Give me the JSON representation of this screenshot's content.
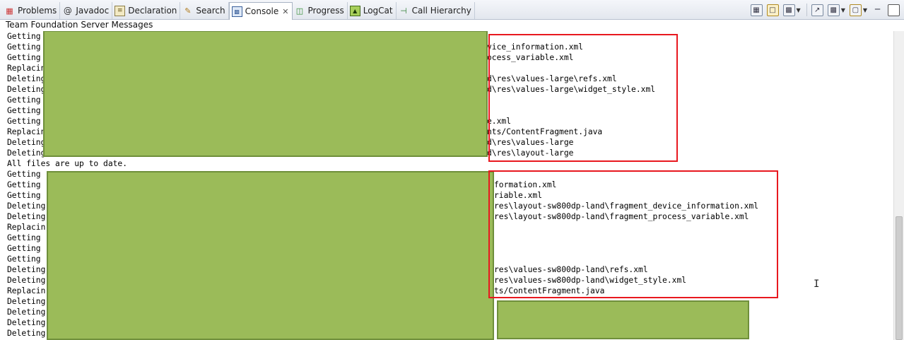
{
  "tabs": [
    {
      "label": "Problems",
      "icon": "problems-icon"
    },
    {
      "label": "Javadoc",
      "icon": "at-sign-icon"
    },
    {
      "label": "Declaration",
      "icon": "declaration-icon"
    },
    {
      "label": "Search",
      "icon": "search-icon"
    },
    {
      "label": "Console",
      "icon": "console-icon",
      "active": true
    },
    {
      "label": "Progress",
      "icon": "progress-icon"
    },
    {
      "label": "LogCat",
      "icon": "logcat-icon"
    },
    {
      "label": "Call Hierarchy",
      "icon": "call-hierarchy-icon"
    }
  ],
  "toolbar_icons": [
    "clear-console-icon",
    "scroll-lock-icon",
    "display-selected-console-icon",
    "pin-console-icon",
    "open-console-icon",
    "new-console-icon",
    "minimize-icon",
    "maximize-icon"
  ],
  "console": {
    "title": "Team Foundation Server Messages",
    "prefixes": [
      "Getting",
      "Getting",
      "Getting",
      "Replacin",
      "Deleting",
      "Deleting",
      "Getting",
      "Getting",
      "Getting",
      "Replacin",
      "Deleting",
      "Deleting",
      "All files are up to date.",
      "Getting",
      "Getting",
      "Getting",
      "Deleting",
      "Deleting",
      "Replacin",
      "Getting",
      "Getting",
      "Getting",
      "Deleting",
      "Deleting",
      "Replacin",
      "Deleting",
      "Deleting",
      "Deleting",
      "Deleting"
    ],
    "suffix_block1": [
      "",
      "vice_information.xml",
      "ocess_variable.xml",
      "",
      "d\\res\\values-large\\refs.xml",
      "d\\res\\values-large\\widget_style.xml",
      "",
      "",
      "e.xml",
      "nts/ContentFragment.java",
      "d\\res\\values-large",
      "d\\res\\layout-large"
    ],
    "suffix_block2": [
      "",
      "formation.xml",
      "riable.xml",
      "res\\layout-sw800dp-land\\fragment_device_information.xml",
      "res\\layout-sw800dp-land\\fragment_process_variable.xml",
      "",
      "",
      "",
      "",
      "res\\values-sw800dp-land\\refs.xml",
      "res\\values-sw800dp-land\\widget_style.xml",
      "ts/ContentFragment.java"
    ]
  },
  "colors": {
    "redaction": "#9bbb59",
    "highlight_box": "#e8181f"
  }
}
